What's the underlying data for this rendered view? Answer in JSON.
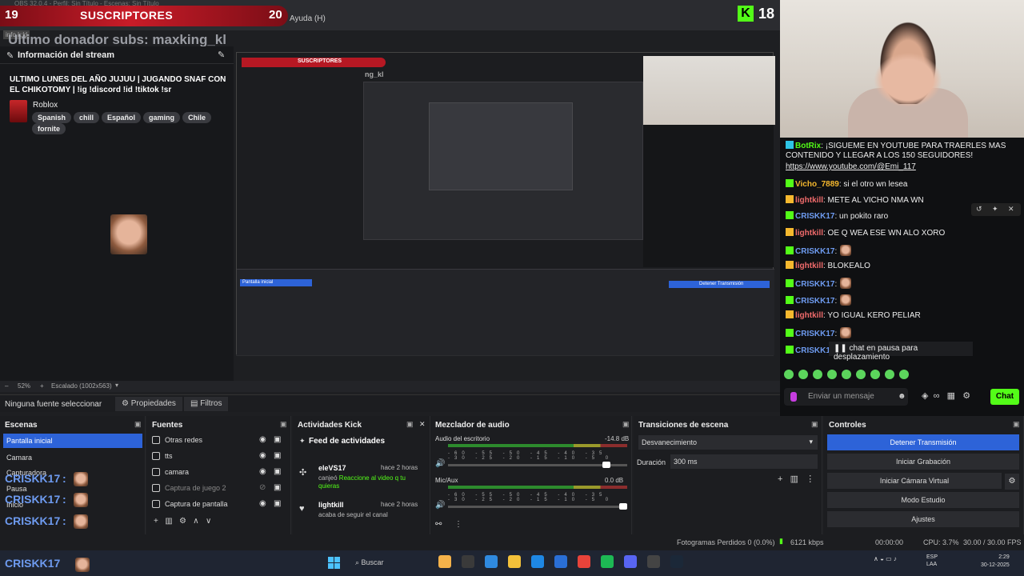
{
  "overlay": {
    "subs_left": "19",
    "subs_title": "SUSCRIPTORES",
    "subs_right": "20",
    "help_menu": "Ayuda (H)",
    "kick_letter": "K",
    "kick_count": "18",
    "obs_title": "OBS 32.0.4 - Perfil: Sin Título - Escenas: Sin Título",
    "donor_line": "Ultimo donador subs: maxking_kl",
    "info_label": "info k:kl"
  },
  "info_panel": {
    "title": "Información del stream",
    "stream_title": "ULTIMO LUNES DEL AÑO JUJUU | JUGANDO SNAF CON EL CHIKOTOMY | !ig !discord !id !tiktok !sr",
    "game": "Roblox",
    "tags": [
      "Spanish",
      "chill",
      "Español",
      "gaming",
      "Chile",
      "fornite"
    ]
  },
  "nested": {
    "subs": "SUSCRIPTORES",
    "donor": "ng_kl",
    "scene": "Pantalla inicial",
    "stop": "Detener Transmisión"
  },
  "zoom": {
    "percent": "52%",
    "scaled": "Escalado (1002x563)"
  },
  "source_toolbar": {
    "no_source": "Ninguna fuente seleccionar",
    "properties": "Propiedades",
    "filters": "Filtros"
  },
  "chat": {
    "messages": [
      {
        "user": "BotRix",
        "text": ": ¡SIGUEME EN YOUTUBE PARA TRAERLES MAS",
        "color": "#53fc18"
      },
      {
        "user": "",
        "text": "CONTENIDO Y LLEGAR A LOS 150 SEGUIDORES!",
        "color": "#eee"
      },
      {
        "user": "",
        "text": "https://www.youtube.com/@Emi_117",
        "color": "#eee"
      },
      {
        "user": "Vicho_7889",
        "text": ": si el otro wn lesea",
        "color": "#f5b82e"
      },
      {
        "user": "lightkill",
        "text": ": METE AL VICHO NMA WN",
        "color": "#f06b6b"
      },
      {
        "user": "CRISKK17",
        "text": ": un pokito raro",
        "color": "#6e9bf0"
      },
      {
        "user": "lightkill",
        "text": ": OE Q WEA ESE WN ALO XORO",
        "color": "#f06b6b"
      },
      {
        "user": "CRISKK17",
        "text": ":",
        "color": "#6e9bf0"
      },
      {
        "user": "lightkill",
        "text": ": BLOKEALO",
        "color": "#f06b6b"
      },
      {
        "user": "CRISKK17",
        "text": ":",
        "color": "#6e9bf0"
      },
      {
        "user": "CRISKK17",
        "text": ":",
        "color": "#6e9bf0"
      },
      {
        "user": "lightkill",
        "text": ": YO IGUAL KERO PELIAR",
        "color": "#f06b6b"
      },
      {
        "user": "CRISKK17",
        "text": ":",
        "color": "#6e9bf0"
      },
      {
        "user": "CRISKK17",
        "text": ":",
        "color": "#6e9bf0"
      }
    ],
    "paused": "chat en pausa para desplazamiento",
    "input_placeholder": "Enviar un mensaje",
    "send": "Chat"
  },
  "docks": {
    "scenes": {
      "title": "Escenas",
      "active": "Pantalla inicial",
      "items": [
        "Camara",
        "Capturadora",
        "Pausa",
        "Inicio"
      ],
      "overlay_user": "CRISKK17",
      "overlay_colon": ":"
    },
    "sources": {
      "title": "Fuentes",
      "items": [
        "Otras redes",
        "tts",
        "camara",
        "Captura de juego 2",
        "Captura de pantalla"
      ]
    },
    "activity": {
      "title": "Actividades Kick",
      "feed_title": "Feed de actividades",
      "items": [
        {
          "user": "eleVS17",
          "time": "hace 2 horas",
          "pre": "canjeó ",
          "hl": "Reaccione al video q tu quieras",
          "post": ""
        },
        {
          "user": "lightkill",
          "time": "hace 2 horas",
          "pre": "acaba de seguir el canal",
          "hl": "",
          "post": ""
        }
      ]
    },
    "mixer": {
      "title": "Mezclador de audio",
      "channels": [
        {
          "name": "Audio del escritorio",
          "db": "-14.8 dB",
          "level": 0.9
        },
        {
          "name": "Mic/Aux",
          "db": "0.0 dB",
          "level": 1.0
        }
      ],
      "scale": "-60 -55 -50 -45 -40 -35 -30 -25 -20 -15 -10 -5 0"
    },
    "transitions": {
      "title": "Transiciones de escena",
      "selected": "Desvanecimiento",
      "duration_label": "Duración",
      "duration": "300 ms"
    },
    "controls": {
      "title": "Controles",
      "buttons": [
        "Detener Transmisión",
        "Iniciar Grabación",
        "Iniciar Cámara Virtual",
        "Modo Estudio",
        "Ajustes"
      ]
    }
  },
  "status": {
    "dropped": "Fotogramas Perdidos 0 (0.0%)",
    "kbps": "6121 kbps",
    "time": "00:00:00",
    "cpu": "CPU: 3.7%",
    "fps": "30.00 / 30.00 FPS"
  },
  "taskbar": {
    "search": "Buscar",
    "lang": "ESP\nLAA",
    "time": "2:29",
    "date": "30-12-2025",
    "app_colors": [
      "#f4b24a",
      "#3a3a3a",
      "#2f8ae0",
      "#f3c13a",
      "#1e88e5",
      "#2a6fd6",
      "#e8433a",
      "#1db954",
      "#5865f2",
      "#444",
      "#1b2838"
    ]
  }
}
